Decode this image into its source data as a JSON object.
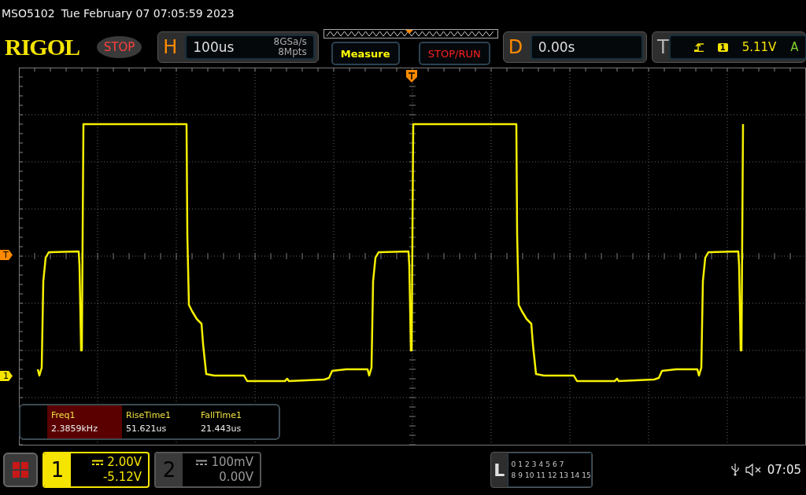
{
  "header": {
    "model": "MSO5102",
    "datetime": "Tue February 07 07:05:59 2023"
  },
  "toolbar": {
    "logo": "RIGOL",
    "run_state": "STOP",
    "horizontal": {
      "label": "H",
      "timebase": "100us",
      "sample_rate": "8GSa/s",
      "memory_depth": "8Mpts"
    },
    "buttons": [
      "Measure",
      "STOP/RUN"
    ],
    "delay": {
      "label": "D",
      "value": "0.00s"
    },
    "trigger": {
      "label": "T",
      "source": "1",
      "level": "5.11V",
      "mode": "A"
    }
  },
  "grid_markers": {
    "trigger_level": "T",
    "channel_1": "1"
  },
  "measurements": [
    {
      "name": "Freq1",
      "value": "2.3859kHz",
      "selected": true
    },
    {
      "name": "RiseTime1",
      "value": "51.621us",
      "selected": false
    },
    {
      "name": "FallTime1",
      "value": "21.443us",
      "selected": false
    }
  ],
  "channels": [
    {
      "number": "1",
      "scale": "2.00V",
      "offset": "-5.12V",
      "on": true
    },
    {
      "number": "2",
      "scale": "100mV",
      "offset": "0.00V",
      "on": false
    }
  ],
  "logic": {
    "label": "L",
    "row_1": [
      "0",
      "1",
      "2",
      "3",
      "4",
      "5",
      "6",
      "7"
    ],
    "row_2": [
      "8",
      "9",
      "10",
      "11",
      "12",
      "13",
      "14",
      "15"
    ]
  },
  "status": {
    "time": "07:05"
  }
}
